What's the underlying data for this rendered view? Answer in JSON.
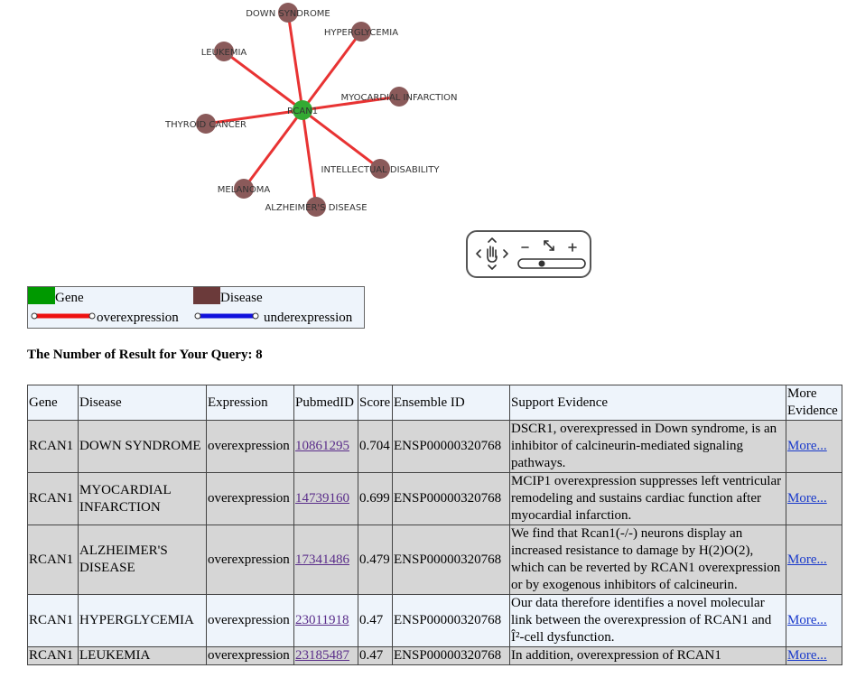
{
  "network": {
    "center": {
      "label": "RCAN1",
      "color": "#33aa33"
    },
    "disease_color": "#8a5a5a",
    "edge_color": "#e83333",
    "nodes": [
      {
        "label": "DOWN SYNDROME"
      },
      {
        "label": "HYPERGLYCEMIA"
      },
      {
        "label": "LEUKEMIA"
      },
      {
        "label": "MYOCARDIAL INFARCTION"
      },
      {
        "label": "THYROID CANCER"
      },
      {
        "label": "INTELLECTUAL DISABILITY"
      },
      {
        "label": "MELANOMA"
      },
      {
        "label": "ALZHEIMER'S DISEASE"
      }
    ]
  },
  "legend": {
    "gene_label": "Gene",
    "gene_color": "#009900",
    "disease_label": "Disease",
    "disease_color": "#6b3a3a",
    "over_label": "overexpression",
    "over_color": "#ee1111",
    "under_label": "underexpression",
    "under_color": "#1111dd"
  },
  "results": {
    "title": "The Number of Result for Your Query: 8",
    "headers": [
      "Gene",
      "Disease",
      "Expression",
      "PubmedID",
      "Score",
      "Ensemble ID",
      "Support Evidence",
      "More Evidence"
    ],
    "rows": [
      {
        "gene": "RCAN1",
        "disease": "DOWN SYNDROME",
        "expression": "overexpression",
        "pubmed": "10861295",
        "score": "0.704",
        "ensembl": "ENSP00000320768",
        "evidence": "DSCR1, overexpressed in Down syndrome, is an inhibitor of calcineurin-mediated signaling pathways.",
        "more": "More..."
      },
      {
        "gene": "RCAN1",
        "disease": "MYOCARDIAL INFARCTION",
        "expression": "overexpression",
        "pubmed": "14739160",
        "score": "0.699",
        "ensembl": "ENSP00000320768",
        "evidence": "MCIP1 overexpression suppresses left ventricular remodeling and sustains cardiac function after myocardial infarction.",
        "more": "More..."
      },
      {
        "gene": "RCAN1",
        "disease": "ALZHEIMER'S DISEASE",
        "expression": "overexpression",
        "pubmed": "17341486",
        "score": "0.479",
        "ensembl": "ENSP00000320768",
        "evidence": "We find that Rcan1(-/-) neurons display an increased resistance to damage by H(2)O(2), which can be reverted by RCAN1 overexpression or by exogenous inhibitors of calcineurin.",
        "more": "More..."
      },
      {
        "gene": "RCAN1",
        "disease": "HYPERGLYCEMIA",
        "expression": "overexpression",
        "pubmed": "23011918",
        "score": "0.47",
        "ensembl": "ENSP00000320768",
        "evidence": "Our data therefore identifies a novel molecular link between the overexpression of RCAN1 and Î²-cell dysfunction.",
        "more": "More..."
      },
      {
        "gene": "RCAN1",
        "disease": "LEUKEMIA",
        "expression": "overexpression",
        "pubmed": "23185487",
        "score": "0.47",
        "ensembl": "ENSP00000320768",
        "evidence": "In addition, overexpression of RCAN1",
        "more": "More..."
      }
    ]
  }
}
